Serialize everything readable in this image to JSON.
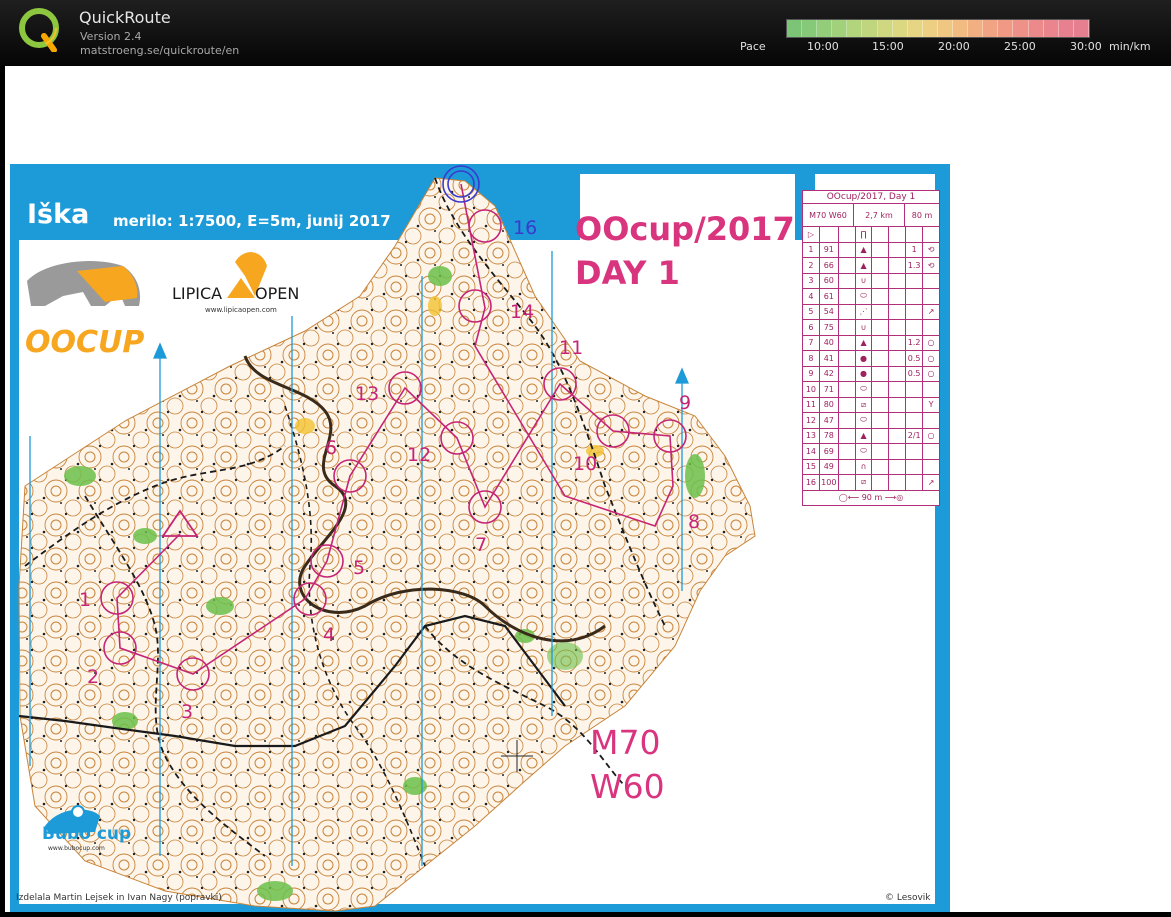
{
  "app": {
    "title": "QuickRoute",
    "version": "Version 2.4",
    "url": "matstroeng.se/quickroute/en"
  },
  "pace": {
    "label": "Pace",
    "ticks": [
      "10:00",
      "15:00",
      "20:00",
      "25:00",
      "30:00"
    ],
    "unit": "min/km",
    "colors": [
      "#7cc576",
      "#86c978",
      "#93cd7a",
      "#a2d17c",
      "#b1d47d",
      "#c0d67e",
      "#cfd880",
      "#dcd882",
      "#e6d583",
      "#edcf84",
      "#f0c683",
      "#f2bb82",
      "#f2af82",
      "#f1a483",
      "#f09a86",
      "#ee9189",
      "#ec8a8b",
      "#ea858d",
      "#e8818f",
      "#e67f90"
    ]
  },
  "map": {
    "name": "Iška",
    "scale_info": "merilo: 1:7500, E=5m, junij 2017",
    "event": "OOcup/2017",
    "day": "DAY 1",
    "class_men": "M70",
    "class_women": "W60",
    "sponsor1": "OOCUP",
    "sponsor2_title": "LIPICA",
    "sponsor2_word": "OPEN",
    "sponsor2_url": "www.lipicaopen.com",
    "sponsor3": "Bubo cup",
    "sponsor3_url": "www.bubocup.com",
    "credits": "Izdelala Martin Lejsek in Ivan Nagy (popravki)",
    "copyright": "© Lesovik",
    "control_labels": [
      "1",
      "2",
      "3",
      "4",
      "5",
      "6",
      "7",
      "8",
      "9",
      "10",
      "11",
      "12",
      "13",
      "14",
      "16"
    ],
    "colors": {
      "frame": "#1d9ad8",
      "course": "#c42575",
      "contour": "#c8843a",
      "vegetation": "#6cc04a",
      "track": "#1a1a1a"
    }
  },
  "control_description": {
    "title": "OOcup/2017, Day 1",
    "class": "M70 W60",
    "length": "2,7 km",
    "climb": "80 m",
    "rows": [
      {
        "n": "1",
        "code": "91",
        "feat": "▲",
        "dim": "1",
        "sym": "⟲"
      },
      {
        "n": "2",
        "code": "66",
        "feat": "▲",
        "dim": "1.3",
        "sym": "⟲"
      },
      {
        "n": "3",
        "code": "60",
        "feat": "∪",
        "dim": "",
        "sym": ""
      },
      {
        "n": "4",
        "code": "61",
        "feat": "⬭",
        "dim": "",
        "sym": ""
      },
      {
        "n": "5",
        "code": "54",
        "feat": "⋰",
        "dim": "",
        "sym": "↗"
      },
      {
        "n": "6",
        "code": "75",
        "feat": "∪",
        "dim": "",
        "sym": ""
      },
      {
        "n": "7",
        "code": "40",
        "feat": "▲",
        "dim": "1.2",
        "sym": "○"
      },
      {
        "n": "8",
        "code": "41",
        "feat": "●",
        "dim": "0.5",
        "sym": "○"
      },
      {
        "n": "9",
        "code": "42",
        "feat": "●",
        "dim": "0.5",
        "sym": "○"
      },
      {
        "n": "10",
        "code": "71",
        "feat": "⬭",
        "dim": "",
        "sym": ""
      },
      {
        "n": "11",
        "code": "80",
        "feat": "⧄",
        "dim": "",
        "sym": "Y"
      },
      {
        "n": "12",
        "code": "47",
        "feat": "⬭",
        "dim": "",
        "sym": ""
      },
      {
        "n": "13",
        "code": "78",
        "feat": "▲",
        "dim": "2/1",
        "sym": "○"
      },
      {
        "n": "14",
        "code": "69",
        "feat": "⬭",
        "dim": "",
        "sym": ""
      },
      {
        "n": "15",
        "code": "49",
        "feat": "∩",
        "dim": "",
        "sym": ""
      },
      {
        "n": "16",
        "code": "100",
        "feat": "⧄",
        "dim": "",
        "sym": "↗"
      }
    ],
    "finish": "90 m"
  }
}
